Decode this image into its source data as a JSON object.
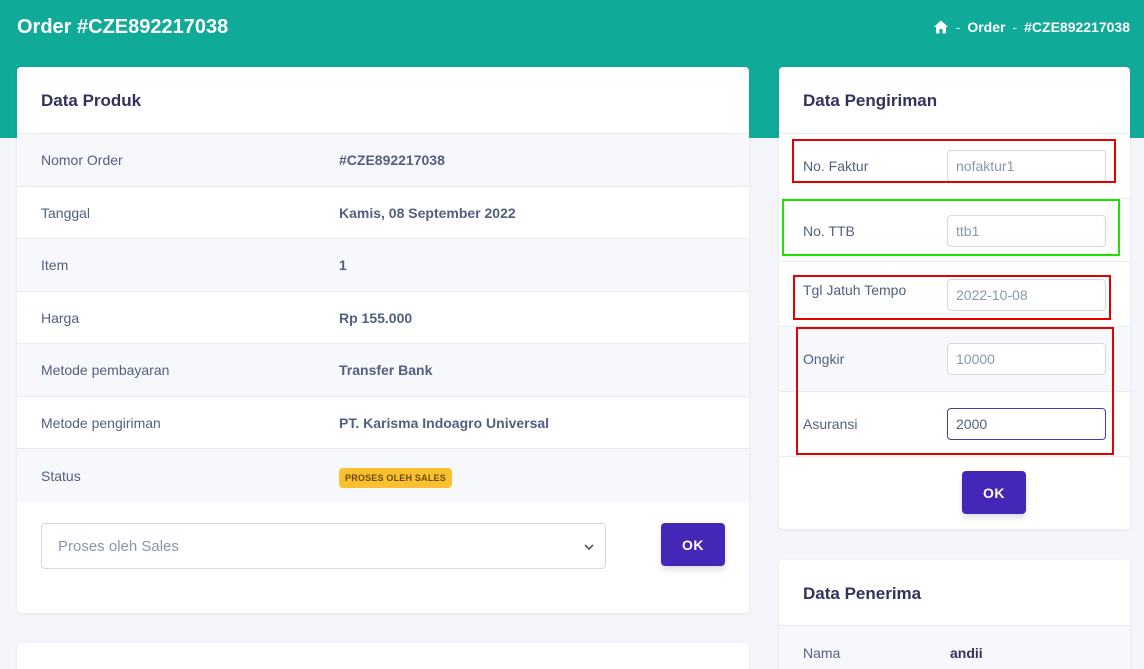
{
  "header": {
    "title": "Order #CZE892217038",
    "breadcrumb": {
      "home_icon": "home-icon",
      "sep": "-",
      "order": "Order",
      "current": "#CZE892217038"
    }
  },
  "produk": {
    "title": "Data Produk",
    "rows": [
      {
        "label": "Nomor Order",
        "value": "#CZE892217038"
      },
      {
        "label": "Tanggal",
        "value": "Kamis, 08 September 2022"
      },
      {
        "label": "Item",
        "value": "1"
      },
      {
        "label": "Harga",
        "value": "Rp 155.000"
      },
      {
        "label": "Metode pembayaran",
        "value": "Transfer Bank"
      },
      {
        "label": "Metode pengiriman",
        "value": "PT. Karisma Indoagro Universal"
      },
      {
        "label": "Status",
        "value": "PROSES OLEH SALES"
      }
    ],
    "status_select": "Proses oleh Sales",
    "ok_label": "OK"
  },
  "pengiriman": {
    "title": "Data Pengiriman",
    "fields": [
      {
        "label": "No. Faktur",
        "value": "nofaktur1"
      },
      {
        "label": "No. TTB",
        "value": "ttb1"
      },
      {
        "label": "Tgl Jatuh Tempo",
        "value": "2022-10-08"
      },
      {
        "label": "Ongkir",
        "value": "10000"
      },
      {
        "label": "Asuransi",
        "value": "2000"
      }
    ],
    "ok_label": "OK"
  },
  "penerima": {
    "title": "Data Penerima",
    "rows": [
      {
        "label": "Nama",
        "value": "andii"
      }
    ]
  },
  "colors": {
    "header_bg": "#0fab98",
    "button": "#4527b8",
    "badge": "#fbc02d",
    "highlight_red": "#e50000",
    "highlight_green": "#22e000"
  }
}
